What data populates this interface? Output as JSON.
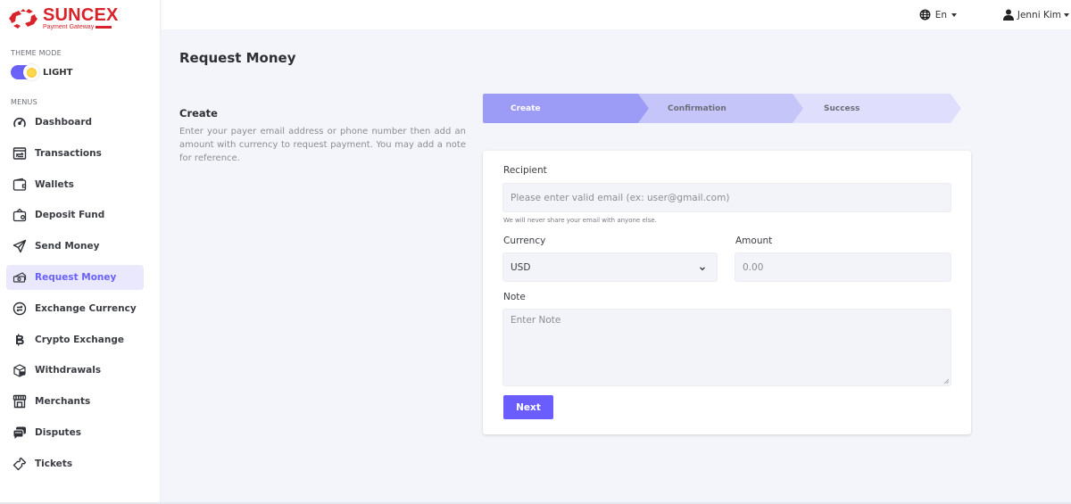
{
  "brand": {
    "name": "SUNCEX",
    "tagline": "Payment Gateway",
    "color": "#d8232a"
  },
  "sidebar": {
    "theme_section_label": "THEME MODE",
    "theme_mode": "LIGHT",
    "theme_toggle_on": true,
    "menus_section_label": "MENUS",
    "items": [
      {
        "label": "Dashboard",
        "icon": "speedometer-icon",
        "active": false
      },
      {
        "label": "Transactions",
        "icon": "transactions-icon",
        "active": false
      },
      {
        "label": "Wallets",
        "icon": "wallet-icon",
        "active": false
      },
      {
        "label": "Deposit Fund",
        "icon": "deposit-icon",
        "active": false
      },
      {
        "label": "Send Money",
        "icon": "paper-plane-icon",
        "active": false
      },
      {
        "label": "Request Money",
        "icon": "money-icon",
        "active": true
      },
      {
        "label": "Exchange Currency",
        "icon": "exchange-icon",
        "active": false
      },
      {
        "label": "Crypto Exchange",
        "icon": "bitcoin-icon",
        "active": false
      },
      {
        "label": "Withdrawals",
        "icon": "box-icon",
        "active": false
      },
      {
        "label": "Merchants",
        "icon": "store-icon",
        "active": false
      },
      {
        "label": "Disputes",
        "icon": "chat-icon",
        "active": false
      },
      {
        "label": "Tickets",
        "icon": "ticket-icon",
        "active": false
      }
    ]
  },
  "topbar": {
    "language": "En",
    "user_name": "Jenni Kim"
  },
  "page": {
    "title": "Request Money",
    "section_title": "Create",
    "section_description": "Enter your payer email address or phone number then add an amount with currency to request payment. You may add a note for reference."
  },
  "stepper": {
    "steps": [
      "Create",
      "Confirmation",
      "Success"
    ],
    "active_index": 0
  },
  "form": {
    "recipient_label": "Recipient",
    "recipient_placeholder": "Please enter valid email (ex: user@gmail.com)",
    "recipient_value": "",
    "recipient_help": "We will never share your email with anyone else.",
    "currency_label": "Currency",
    "currency_selected": "USD",
    "amount_label": "Amount",
    "amount_placeholder": "0.00",
    "note_label": "Note",
    "note_placeholder": "Enter Note",
    "next_label": "Next"
  },
  "colors": {
    "accent": "#6a62f6",
    "button": "#6a5cfd",
    "active_menu_bg": "#e9e8fd",
    "step_active": "#9c9bf5",
    "step_next": "#c6c5fa",
    "step_last": "#dfdffd"
  }
}
